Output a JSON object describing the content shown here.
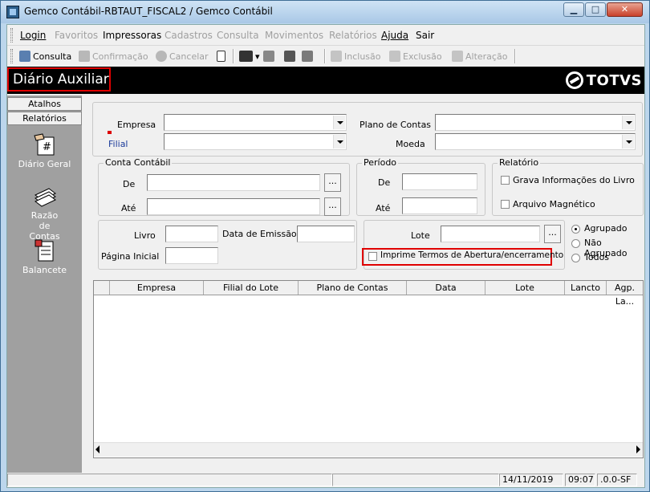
{
  "window": {
    "title": "Gemco Contábil-RBTAUT_FISCAL2 / Gemco Contábil"
  },
  "menu": [
    {
      "label": "Login",
      "enabled": true
    },
    {
      "label": "Favoritos",
      "enabled": false
    },
    {
      "label": "Impressoras",
      "enabled": true
    },
    {
      "label": "Cadastros",
      "enabled": false
    },
    {
      "label": "Consulta",
      "enabled": false
    },
    {
      "label": "Movimentos",
      "enabled": false
    },
    {
      "label": "Relatórios",
      "enabled": false
    },
    {
      "label": "Ajuda",
      "enabled": true
    },
    {
      "label": "Sair",
      "enabled": true
    }
  ],
  "toolbar": {
    "consulta": "Consulta",
    "confirmacao": "Confirmação",
    "cancelar": "Cancelar",
    "inclusao": "Inclusão",
    "exclusao": "Exclusão",
    "alteracao": "Alteração"
  },
  "header": {
    "page_title": "Diário Auxiliar",
    "brand": "TOTVS"
  },
  "sidebar": {
    "tabs": [
      "Atalhos",
      "Relatórios"
    ],
    "items": [
      "Diário Geral",
      "Razão de Contas",
      "Balancete"
    ]
  },
  "form": {
    "empresa_label": "Empresa",
    "filial_label": "Filial",
    "plano_label": "Plano de Contas",
    "moeda_label": "Moeda",
    "conta_group": "Conta Contábil",
    "de_label": "De",
    "ate_label": "Até",
    "periodo_group": "Período",
    "periodo_de": "De",
    "periodo_ate": "Até",
    "relatorio_group": "Relatório",
    "grava_label": "Grava Informações do Livro",
    "arquivo_label": "Arquivo Magnético",
    "livro_label": "Livro",
    "data_emissao_label": "Data de Emissão",
    "pagina_label": "Página Inicial",
    "lote_label": "Lote",
    "imprime_label": "Imprime Termos de Abertura/encerramento",
    "radios": [
      {
        "label": "Agrupado",
        "selected": true
      },
      {
        "label": "Não Agrupado",
        "selected": false
      },
      {
        "label": "Todos",
        "selected": false
      }
    ],
    "dots": "..."
  },
  "grid": {
    "columns": [
      "Empresa",
      "Filial do Lote",
      "Plano de Contas",
      "Data",
      "Lote",
      "Lancto",
      "Agp. La..."
    ]
  },
  "status": {
    "date": "14/11/2019",
    "time": "09:07",
    "version": ".0.0-SF"
  }
}
